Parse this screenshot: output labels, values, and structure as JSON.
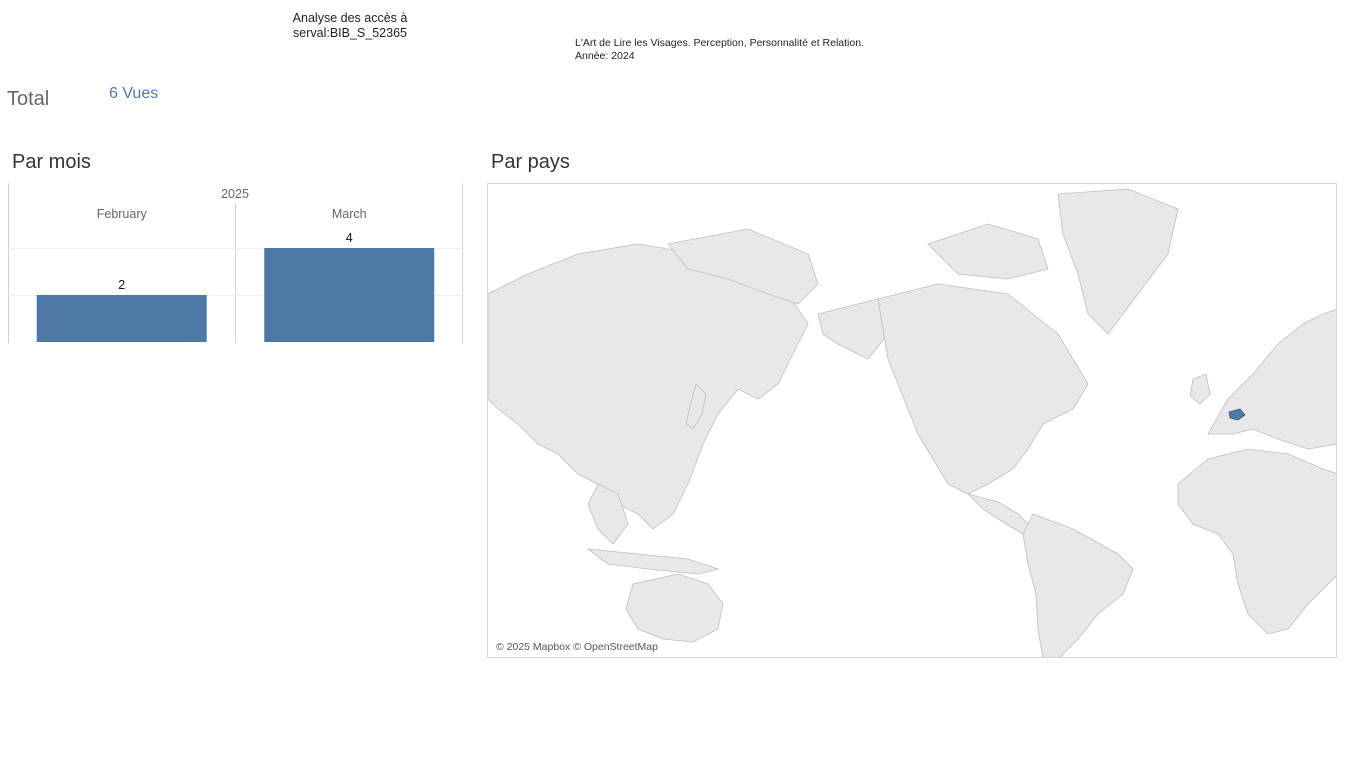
{
  "header": {
    "title_line1": "Analyse des accès à",
    "title_line2": "serval:BIB_S_52365",
    "doc_title": "L'Art de Lire les Visages. Perception, Personnalité et Relation.",
    "doc_year": "Année: 2024"
  },
  "summary": {
    "total_label": "Total",
    "total_value": "6 Vues"
  },
  "sections": {
    "by_month": "Par mois",
    "by_country": "Par pays"
  },
  "chart_data": {
    "type": "bar",
    "year": "2025",
    "categories": [
      "February",
      "March"
    ],
    "values": [
      2,
      4
    ],
    "ylim": [
      0,
      4
    ],
    "color": "#4e79a7"
  },
  "map": {
    "credit": "© 2025 Mapbox © OpenStreetMap",
    "highlighted_country": "Switzerland",
    "land_color": "#e8e8e8",
    "highlight_color": "#4e79a7"
  }
}
